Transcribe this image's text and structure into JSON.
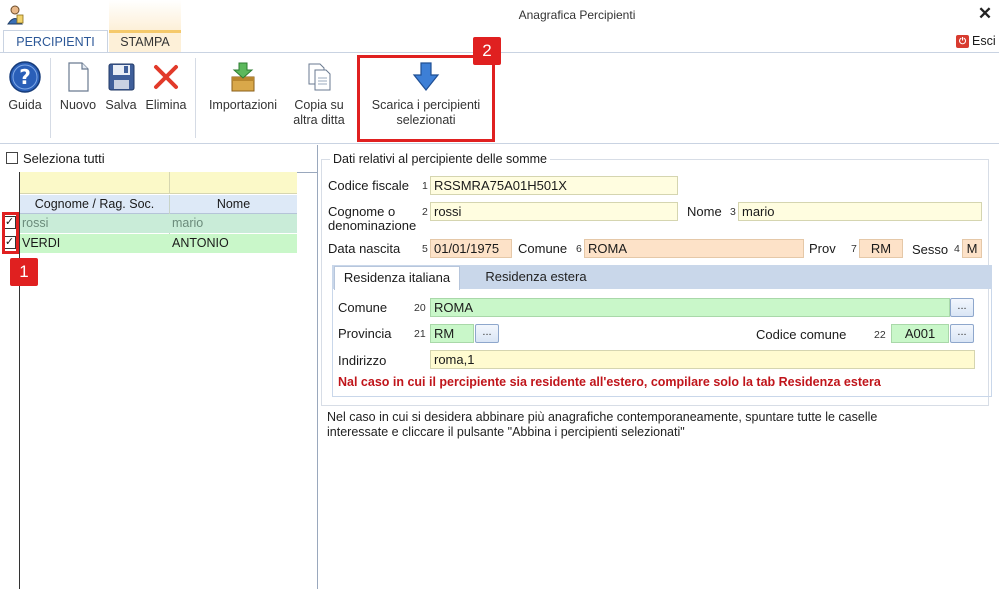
{
  "window": {
    "title": "Anagrafica Percipienti",
    "close_glyph": "✕"
  },
  "tabs": [
    {
      "label": "PERCIPIENTI",
      "active": true
    },
    {
      "label": "STAMPA",
      "active": false
    }
  ],
  "esci": {
    "label": "Esci",
    "icon": "power-icon"
  },
  "toolbar": {
    "guida": "Guida",
    "nuovo": "Nuovo",
    "salva": "Salva",
    "elimina": "Elimina",
    "importazioni": "Importazioni",
    "copia_line1": "Copia su",
    "copia_line2": "altra ditta",
    "scarica_line1": "Scarica i percipienti",
    "scarica_line2": "selezionati"
  },
  "callouts": {
    "one": "1",
    "two": "2"
  },
  "list": {
    "select_all": "Seleziona tutti",
    "columns": [
      "Cognome / Rag. Soc.",
      "Nome"
    ],
    "rows": [
      {
        "cognome": "rossi",
        "nome": "mario",
        "checked": true
      },
      {
        "cognome": "VERDI",
        "nome": "ANTONIO",
        "checked": true
      }
    ]
  },
  "form": {
    "legend": "Dati relativi al percipiente delle somme",
    "codice_fiscale": {
      "label": "Codice fiscale",
      "num": "1",
      "value": "RSSMRA75A01H501X"
    },
    "cognome": {
      "label1": "Cognome o",
      "label2": "denominazione",
      "num": "2",
      "value": "rossi"
    },
    "nome": {
      "label": "Nome",
      "num": "3",
      "value": "mario"
    },
    "data_nascita": {
      "label": "Data nascita",
      "num": "5",
      "value": "01/01/1975"
    },
    "comune_nascita": {
      "label": "Comune",
      "num": "6",
      "value": "ROMA"
    },
    "prov": {
      "label": "Prov",
      "num": "7",
      "value": "RM"
    },
    "sesso": {
      "label": "Sesso",
      "num": "4",
      "value": "M"
    }
  },
  "residenza": {
    "tabs": [
      "Residenza italiana",
      "Residenza estera"
    ],
    "comune": {
      "label": "Comune",
      "num": "20",
      "value": "ROMA"
    },
    "provincia": {
      "label": "Provincia",
      "num": "21",
      "value": "RM"
    },
    "codice_comune": {
      "label": "Codice comune",
      "num": "22",
      "value": "A001"
    },
    "indirizzo": {
      "label": "Indirizzo",
      "value": "roma,1"
    },
    "dots": "...",
    "warning": "Nal caso in cui il percipiente sia residente all'estero, compilare solo la tab Residenza estera"
  },
  "info": {
    "line1": "Nel caso in cui si desidera abbinare più anagrafiche contemporaneamente, spuntare tutte le caselle",
    "line2": "interessate e cliccare il pulsante \"Abbina i percipienti selezionati\""
  },
  "colors": {
    "highlight": "#e02020",
    "green_row": "#c9f7c9",
    "warning": "#c0151b"
  }
}
